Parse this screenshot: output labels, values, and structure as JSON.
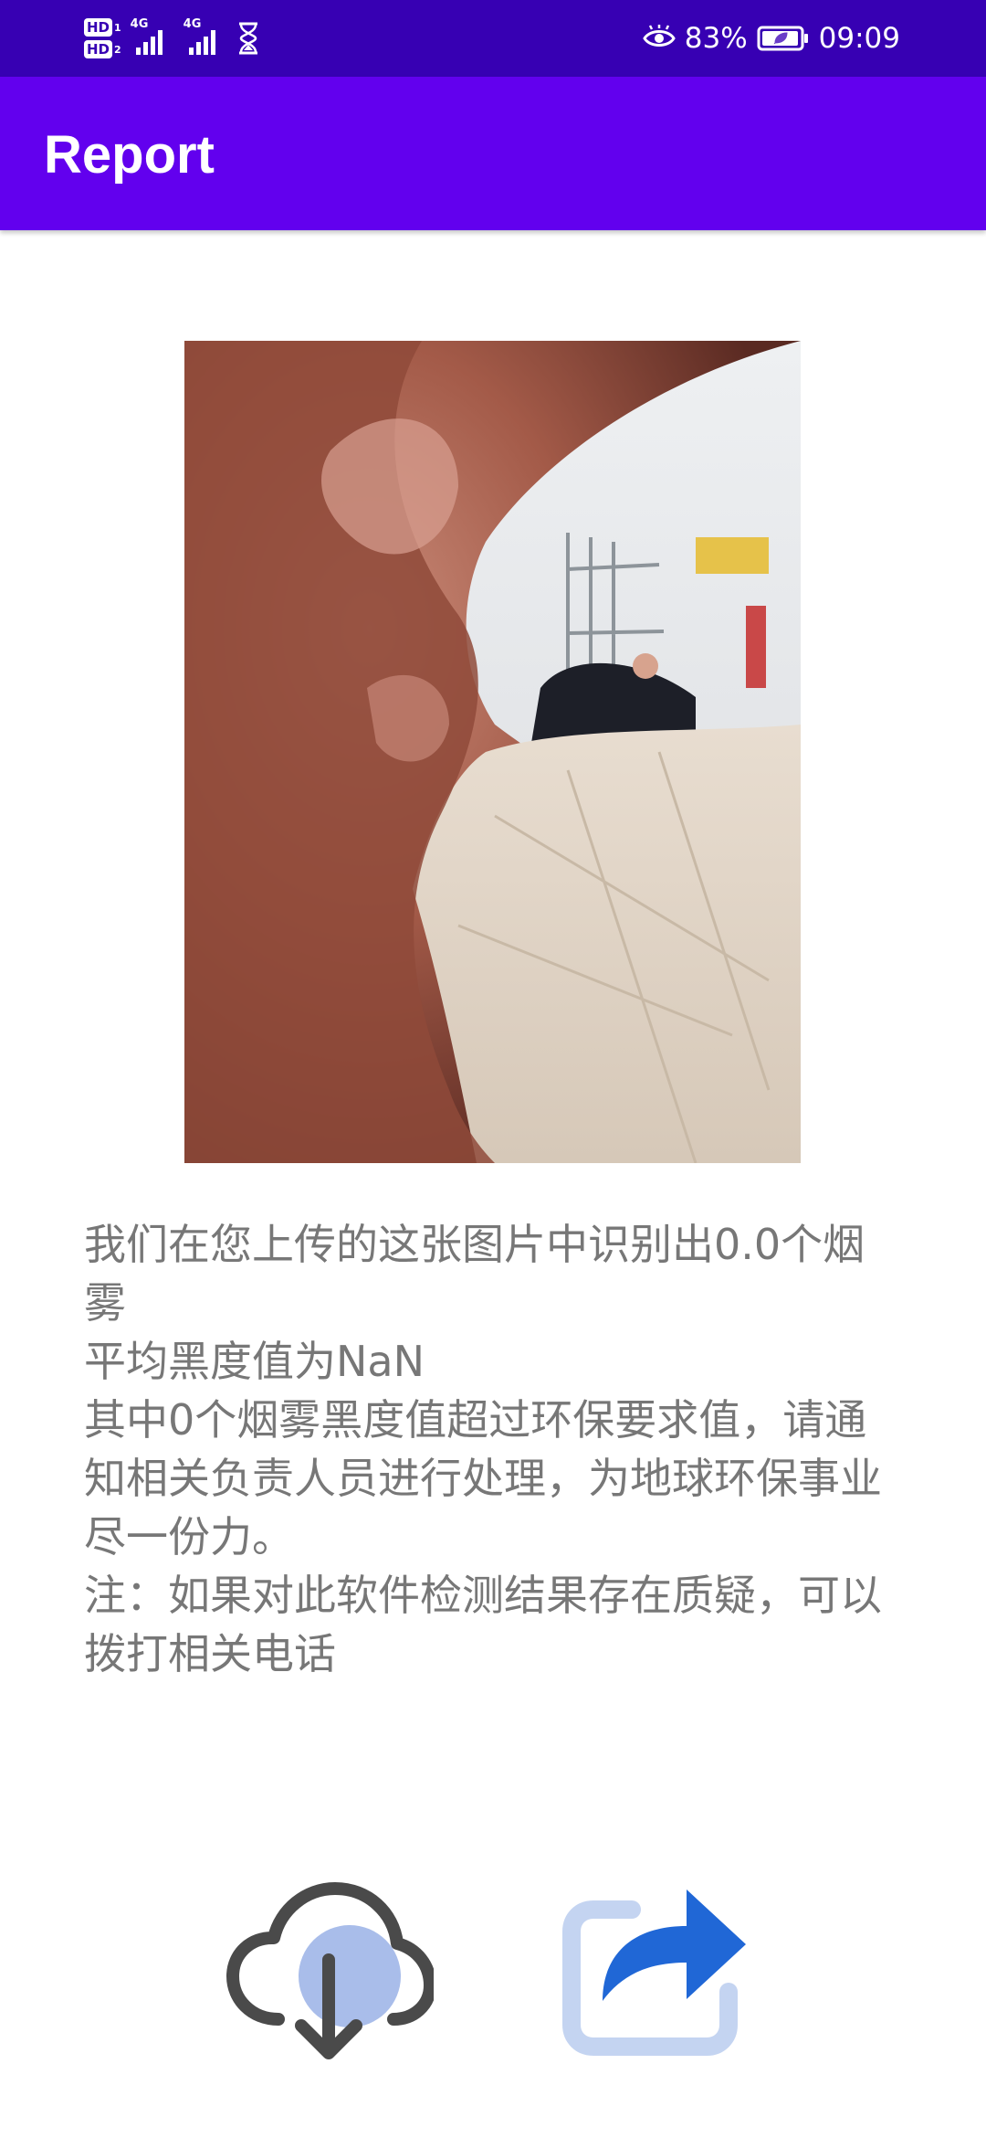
{
  "status_bar": {
    "hd1": "HD",
    "hd1_sim": "1",
    "hd2": "HD",
    "hd2_sim": "2",
    "sim1_network": "4G",
    "sim2_network": "4G",
    "battery": "83%",
    "time": "09:09"
  },
  "app_bar": {
    "title": "Report"
  },
  "message": {
    "line1": "我们在您上传的这张图片中识别出0.0个烟雾",
    "line2": "平均黑度值为NaN",
    "line3": "其中0个烟雾黑度值超过环保要求值，请通知相关负责人员进行处理，为地球环保事业尽一份力。",
    "line4": "注：如果对此软件检测结果存在质疑，可以拨打相关电话"
  },
  "icons": {
    "download": "cloud-download-icon",
    "share": "share-icon",
    "eye": "eye-comfort-icon",
    "battery": "battery-icon",
    "hourglass": "hourglass-icon"
  },
  "colors": {
    "status_bar": "#3700b3",
    "app_bar": "#6200ee",
    "text": "#777777",
    "share_accent": "#2067d6",
    "download_accent": "#a9bdea"
  }
}
